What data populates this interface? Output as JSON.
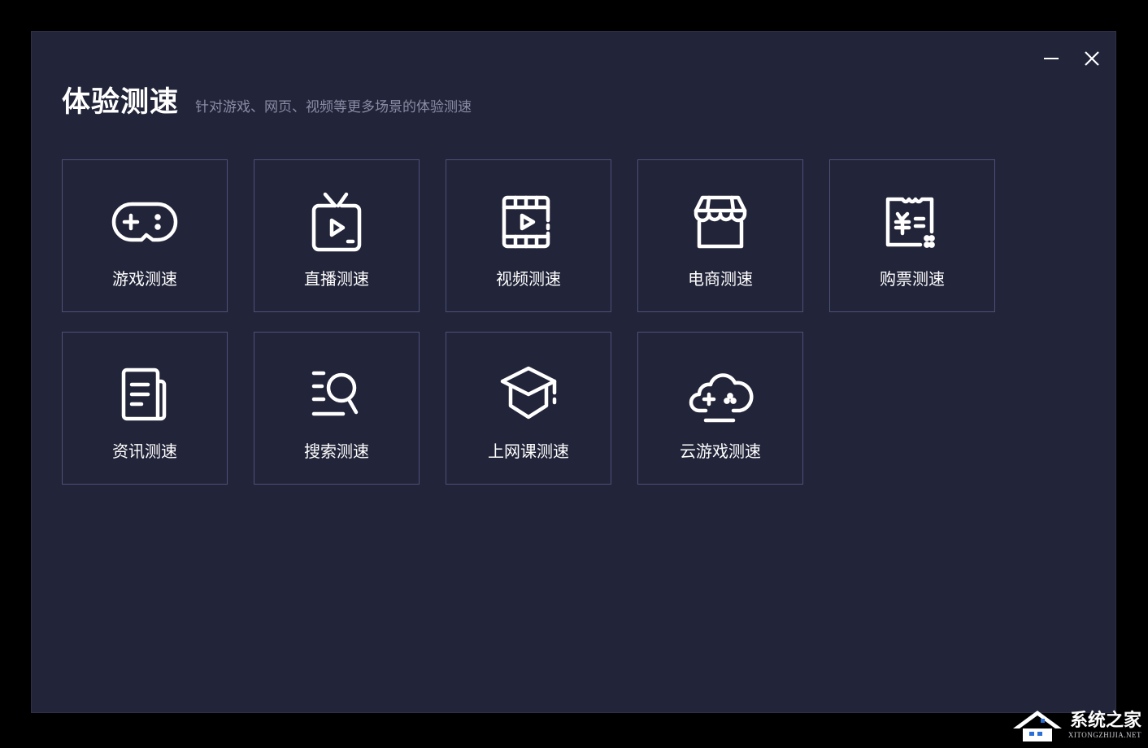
{
  "header": {
    "title": "体验测速",
    "subtitle": "针对游戏、网页、视频等更多场景的体验测速"
  },
  "tiles": [
    {
      "label": "游戏测速",
      "icon": "gamepad-icon"
    },
    {
      "label": "直播测速",
      "icon": "tv-icon"
    },
    {
      "label": "视频测速",
      "icon": "film-icon"
    },
    {
      "label": "电商测速",
      "icon": "store-icon"
    },
    {
      "label": "购票测速",
      "icon": "ticket-icon"
    },
    {
      "label": "资讯测速",
      "icon": "news-icon"
    },
    {
      "label": "搜索测速",
      "icon": "search-icon"
    },
    {
      "label": "上网课测速",
      "icon": "graduation-cap-icon"
    },
    {
      "label": "云游戏测速",
      "icon": "cloud-gamepad-icon"
    }
  ],
  "watermark": {
    "main": "系统之家",
    "sub": "XITONGZHIJIA.NET"
  },
  "colors": {
    "background": "#222439",
    "tile_border": "#4d5078",
    "text": "#ffffff",
    "subtitle": "#8a8ca6"
  }
}
